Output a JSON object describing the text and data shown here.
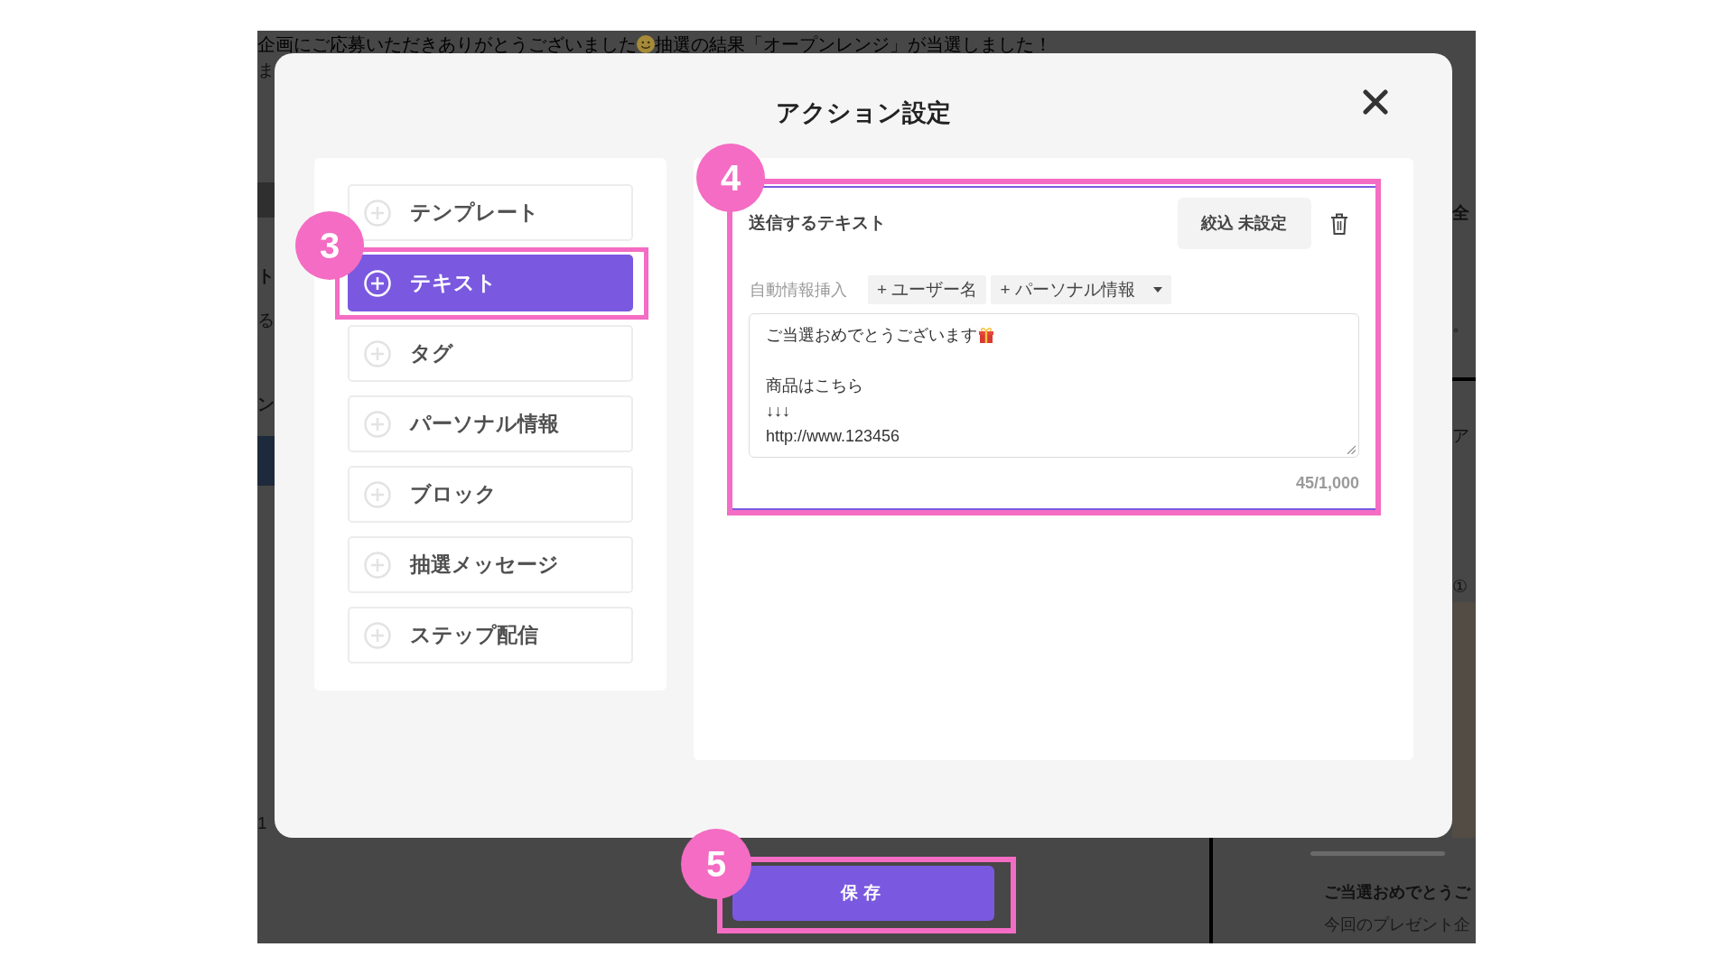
{
  "background_page": {
    "notice": [
      "企画にご応募いただきありがとうございました",
      "抽選の結果「オープンレンジ」が当選しました！"
    ],
    "left_fragments": [
      "ま",
      "ト",
      "る",
      "ン",
      "1"
    ],
    "right_fragments": [
      "全",
      "。",
      "ア",
      "①"
    ],
    "preview": {
      "title": "ご当選おめでとうご",
      "body": "今回のプレゼント企"
    }
  },
  "dialog": {
    "title": "アクション設定",
    "menu": [
      {
        "label": "テンプレート",
        "selected": false
      },
      {
        "label": "テキスト",
        "selected": true,
        "badge": "3"
      },
      {
        "label": "タグ",
        "selected": false
      },
      {
        "label": "パーソナル情報",
        "selected": false
      },
      {
        "label": "ブロック",
        "selected": false
      },
      {
        "label": "抽選メッセージ",
        "selected": false
      },
      {
        "label": "ステップ配信",
        "selected": false
      }
    ],
    "text_card": {
      "badge": "4",
      "title": "送信するテキスト",
      "filter_button": "絞込 未設定",
      "insert_label": "自動情報挿入",
      "insert_chips": [
        {
          "label": "+ ユーザー名",
          "kind": "button"
        },
        {
          "label": "+ パーソナル情報",
          "kind": "dropdown"
        }
      ],
      "message_paragraphs": [
        {
          "lines": [
            "ご当選おめでとうございます"
          ]
        },
        {
          "lines": [
            "商品はこちら",
            "↓↓↓",
            "http://www.123456"
          ]
        }
      ],
      "counter": "45/1,000"
    }
  },
  "save_button": {
    "label": "保存",
    "badge": "5"
  }
}
